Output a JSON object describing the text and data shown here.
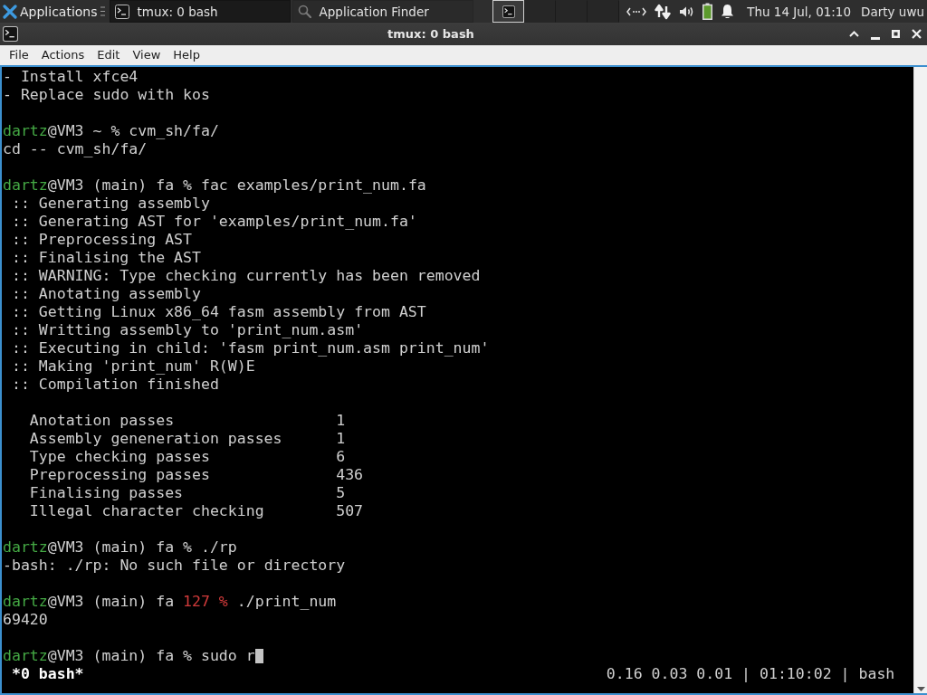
{
  "panel": {
    "app_menu": "Applications",
    "tasks": [
      {
        "kind": "terminal",
        "title": "tmux: 0 bash",
        "selected": true
      },
      {
        "kind": "finder",
        "title": "Application Finder",
        "selected": false
      }
    ],
    "workspaces": [
      {
        "has_window": true
      },
      {
        "has_window": false
      },
      {
        "has_window": false
      },
      {
        "has_window": false
      }
    ],
    "clock": "Thu 14 Jul, 01:10",
    "user": "Darty uwu"
  },
  "window": {
    "title": "tmux: 0 bash"
  },
  "menu": [
    "File",
    "Actions",
    "Edit",
    "View",
    "Help"
  ],
  "terminal": {
    "blocks": [
      {
        "lines": [
          {
            "kind": "output",
            "text": "- Install xfce4"
          },
          {
            "kind": "output",
            "text": "- Replace sudo with kos"
          }
        ]
      },
      {
        "lines": [
          {
            "kind": "prompt",
            "user": "dartz",
            "host": "@VM3 ~",
            "mark": "%",
            "error": false,
            "command": "cvm_sh/fa/",
            "cursor": false
          },
          {
            "kind": "output",
            "text": "cd -- cvm_sh/fa/"
          }
        ]
      },
      {
        "lines": [
          {
            "kind": "prompt",
            "user": "dartz",
            "host": "@VM3 (main) fa",
            "mark": "%",
            "error": false,
            "command": "fac examples/print_num.fa",
            "cursor": false
          },
          {
            "kind": "step",
            "text": ":: Generating assembly"
          },
          {
            "kind": "step",
            "text": ":: Generating AST for 'examples/print_num.fa'"
          },
          {
            "kind": "step",
            "text": ":: Preprocessing AST"
          },
          {
            "kind": "step",
            "text": ":: Finalising the AST"
          },
          {
            "kind": "step",
            "text": ":: WARNING: Type checking currently has been removed"
          },
          {
            "kind": "step",
            "text": ":: Anotating assembly"
          },
          {
            "kind": "step",
            "text": ":: Getting Linux x86_64 fasm assembly from AST"
          },
          {
            "kind": "step",
            "text": ":: Writting assembly to 'print_num.asm'"
          },
          {
            "kind": "step",
            "text": ":: Executing in child: 'fasm print_num.asm print_num'"
          },
          {
            "kind": "step",
            "text": ":: Making 'print_num' R(W)E"
          },
          {
            "kind": "step",
            "text": ":: Compilation finished"
          }
        ]
      },
      {
        "lines": [
          {
            "kind": "stat",
            "label": "Anotation passes",
            "value": "1"
          },
          {
            "kind": "stat",
            "label": "Assembly geneneration passes",
            "value": "1"
          },
          {
            "kind": "stat",
            "label": "Type checking passes",
            "value": "6"
          },
          {
            "kind": "stat",
            "label": "Preprocessing passes",
            "value": "436"
          },
          {
            "kind": "stat",
            "label": "Finalising passes",
            "value": "5"
          },
          {
            "kind": "stat",
            "label": "Illegal character checking",
            "value": "507"
          }
        ]
      },
      {
        "lines": [
          {
            "kind": "prompt",
            "user": "dartz",
            "host": "@VM3 (main) fa",
            "mark": "%",
            "error": false,
            "command": "./rp",
            "cursor": false
          },
          {
            "kind": "output",
            "text": "-bash: ./rp: No such file or directory"
          }
        ]
      },
      {
        "lines": [
          {
            "kind": "prompt",
            "user": "dartz",
            "host": "@VM3 (main) fa",
            "mark": "127 %",
            "error": true,
            "command": "./print_num",
            "cursor": false
          },
          {
            "kind": "output",
            "text": "69420"
          }
        ]
      },
      {
        "lines": [
          {
            "kind": "prompt",
            "user": "dartz",
            "host": "@VM3 (main) fa",
            "mark": "%",
            "error": false,
            "command": "sudo r",
            "cursor": true
          }
        ]
      }
    ],
    "status_bar": {
      "window": "*0 bash*",
      "info": "0.16 0.03 0.01 | 01:10:02 | bash"
    }
  }
}
